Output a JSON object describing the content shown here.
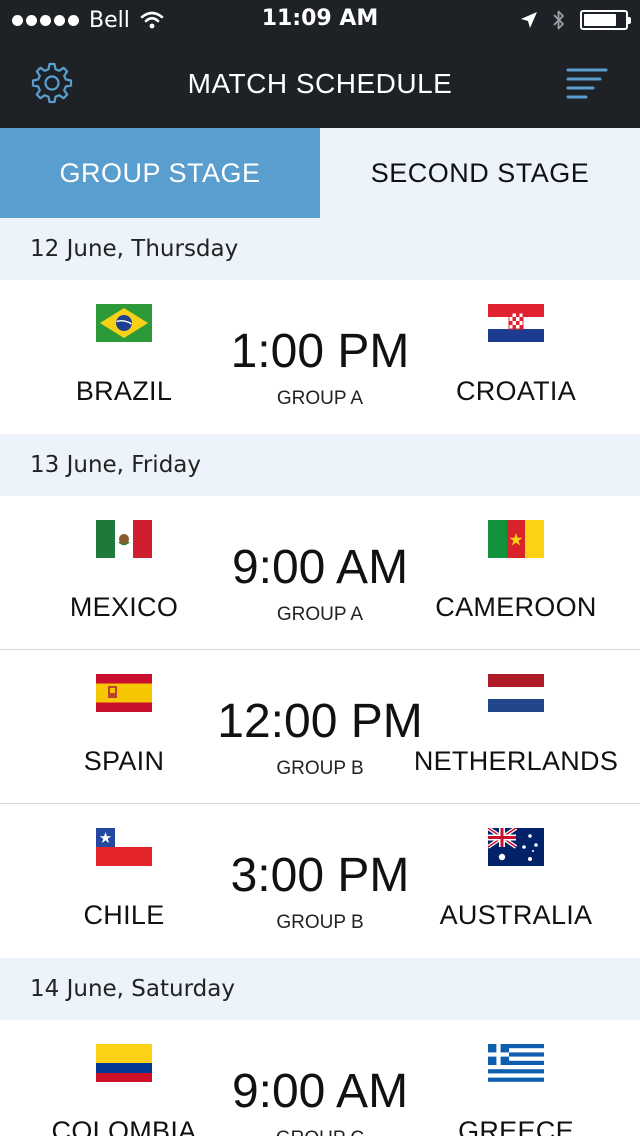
{
  "status_bar": {
    "carrier": "Bell",
    "time": "11:09 AM",
    "battery_level": 0.8
  },
  "nav": {
    "title": "MATCH SCHEDULE",
    "left_icon": "gear-icon",
    "right_icon": "menu-icon"
  },
  "tabs": [
    {
      "label": "GROUP STAGE",
      "active": true
    },
    {
      "label": "SECOND STAGE",
      "active": false
    }
  ],
  "colors": {
    "nav_background": "#1e2227",
    "accent": "#5a9ecf",
    "section_background": "#ecf3fa"
  },
  "days": [
    {
      "date": "12 June, Thursday",
      "matches": [
        {
          "home": "BRAZIL",
          "away": "CROATIA",
          "time": "1:00 PM",
          "group": "GROUP A"
        }
      ]
    },
    {
      "date": "13 June, Friday",
      "matches": [
        {
          "home": "MEXICO",
          "away": "CAMEROON",
          "time": "9:00 AM",
          "group": "GROUP A"
        },
        {
          "home": "SPAIN",
          "away": "NETHERLANDS",
          "time": "12:00 PM",
          "group": "GROUP B"
        },
        {
          "home": "CHILE",
          "away": "AUSTRALIA",
          "time": "3:00 PM",
          "group": "GROUP B"
        }
      ]
    },
    {
      "date": "14 June, Saturday",
      "matches": [
        {
          "home": "COLOMBIA",
          "away": "GREECE",
          "time": "9:00 AM",
          "group": "GROUP C"
        }
      ]
    }
  ]
}
